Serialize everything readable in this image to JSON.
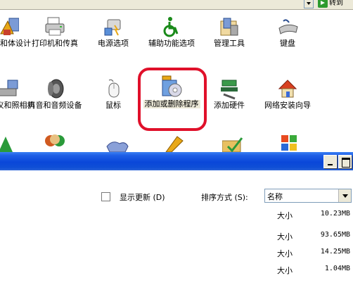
{
  "control_panel": {
    "address_go_label": "转到",
    "rows": [
      [
        {
          "label": "显示和体设计",
          "icon": "display-icon"
        },
        {
          "label": "打印机和传真",
          "icon": "printer-icon"
        },
        {
          "label": "电源选项",
          "icon": "power-icon"
        },
        {
          "label": "辅助功能选项",
          "icon": "accessibility-icon"
        },
        {
          "label": "管理工具",
          "icon": "admin-tools-icon"
        },
        {
          "label": "键盘",
          "icon": "keyboard-icon"
        }
      ],
      [
        {
          "label": "扫描仪和照相机",
          "icon": "scanner-icon"
        },
        {
          "label": "声音和音频设备",
          "icon": "speaker-icon"
        },
        {
          "label": "鼠标",
          "icon": "mouse-icon"
        },
        {
          "label": "添加或删除程序",
          "icon": "add-remove-programs-icon"
        },
        {
          "label": "添加硬件",
          "icon": "add-hardware-icon"
        },
        {
          "label": "网络安装向导",
          "icon": "network-wizard-icon"
        }
      ]
    ]
  },
  "add_remove_window": {
    "show_updates_label": "显示更新 (D)",
    "sort_by_label": "排序方式 (S):",
    "sort_value": "名称",
    "programs": [
      {
        "size_label": "大小",
        "size": "10.23MB"
      },
      {
        "size_label": "大小",
        "size": "93.65MB"
      },
      {
        "size_label": "大小",
        "size": "14.25MB"
      },
      {
        "size_label": "大小",
        "size": "1.04MB"
      }
    ]
  }
}
